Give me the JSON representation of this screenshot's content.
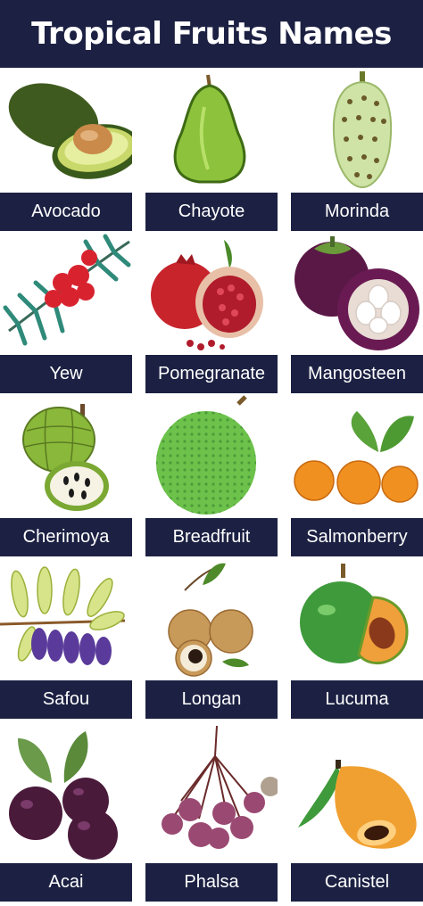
{
  "title": "Tropical Fruits Names",
  "fruits": [
    {
      "name": "Avocado",
      "icon": "avocado-icon"
    },
    {
      "name": "Chayote",
      "icon": "chayote-icon"
    },
    {
      "name": "Morinda",
      "icon": "morinda-icon"
    },
    {
      "name": "Yew",
      "icon": "yew-icon"
    },
    {
      "name": "Pomegranate",
      "icon": "pomegranate-icon"
    },
    {
      "name": "Mangosteen",
      "icon": "mangosteen-icon"
    },
    {
      "name": "Cherimoya",
      "icon": "cherimoya-icon"
    },
    {
      "name": "Breadfruit",
      "icon": "breadfruit-icon"
    },
    {
      "name": "Salmonberry",
      "icon": "salmonberry-icon"
    },
    {
      "name": "Safou",
      "icon": "safou-icon"
    },
    {
      "name": "Longan",
      "icon": "longan-icon"
    },
    {
      "name": "Lucuma",
      "icon": "lucuma-icon"
    },
    {
      "name": "Acai",
      "icon": "acai-icon"
    },
    {
      "name": "Phalsa",
      "icon": "phalsa-icon"
    },
    {
      "name": "Canistel",
      "icon": "canistel-icon"
    }
  ],
  "colors": {
    "banner": "#1c2143",
    "text": "#ffffff"
  }
}
